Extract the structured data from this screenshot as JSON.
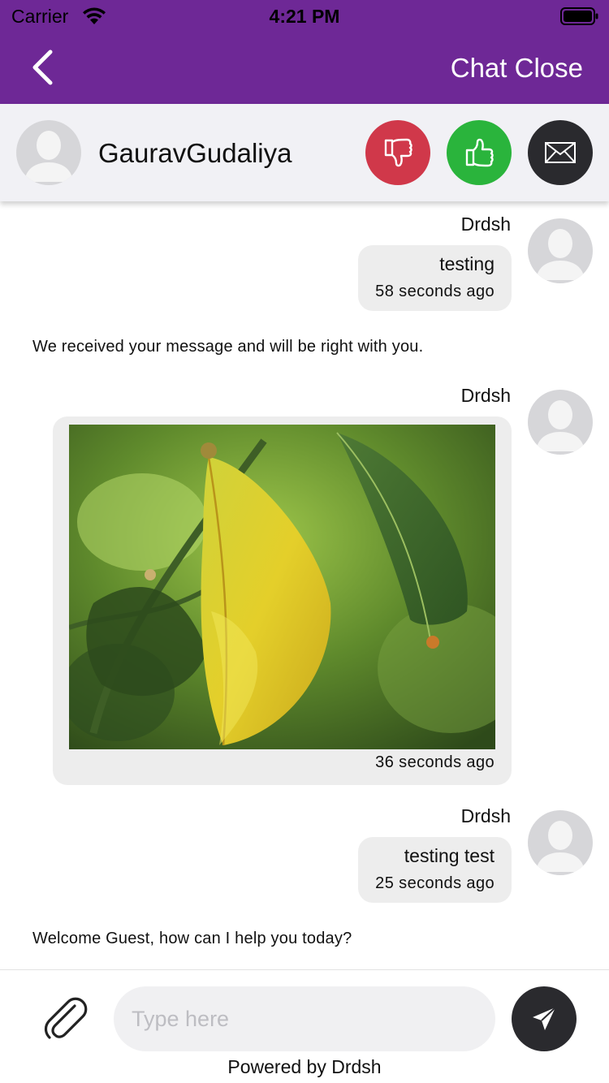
{
  "status_bar": {
    "carrier": "Carrier",
    "time": "4:21 PM"
  },
  "nav": {
    "title": "Chat Close"
  },
  "agent": {
    "name": "GauravGudaliya"
  },
  "colors": {
    "nav": "#6e2896",
    "dislike": "#d0384a",
    "like": "#2ab43c",
    "mail": "#2a2a2e",
    "bubble": "#ededed"
  },
  "icons": [
    "back-chevron-icon",
    "thumbs-down-icon",
    "thumbs-up-icon",
    "envelope-icon",
    "paperclip-icon",
    "send-icon",
    "avatar-placeholder-icon",
    "wifi-icon",
    "battery-icon"
  ],
  "messages": [
    {
      "sender": "Drdsh",
      "text": "testing",
      "time": "58 seconds ago"
    },
    {
      "system": "We received your message and will be right with you."
    },
    {
      "sender": "Drdsh",
      "image": "leaf-photo",
      "time": "36 seconds ago"
    },
    {
      "sender": "Drdsh",
      "text": "testing test",
      "time": "25 seconds ago"
    },
    {
      "system": "Welcome Guest, how can I help you today?"
    }
  ],
  "composer": {
    "placeholder": "Type here",
    "powered_by": "Powered by Drdsh"
  }
}
